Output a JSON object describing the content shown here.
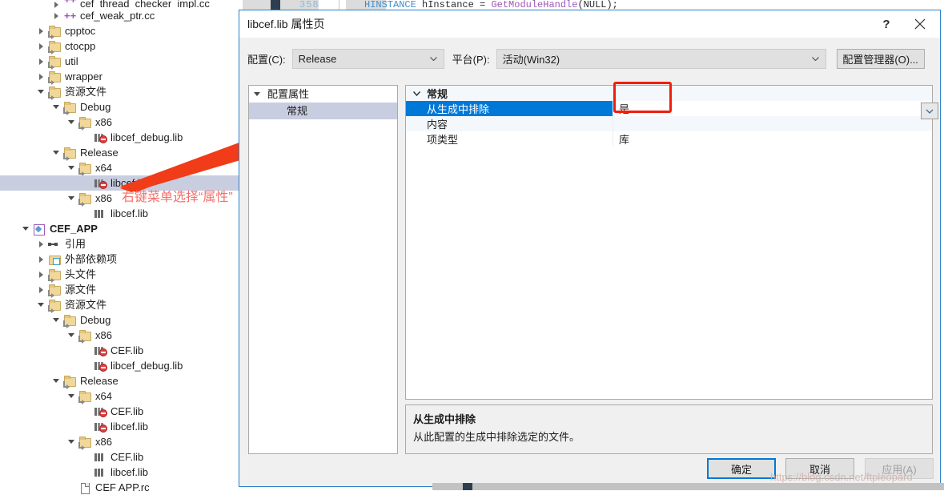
{
  "background": {
    "line_number": "358",
    "code_tokens": [
      {
        "t": "HINSTANCE",
        "c": "kw"
      },
      {
        "t": " hInstance ",
        "c": "id"
      },
      {
        "t": "= ",
        "c": "pn"
      },
      {
        "t": "GetModuleHandle",
        "c": "fn"
      },
      {
        "t": "(NULL);",
        "c": "pn"
      }
    ],
    "code_plain": "HINSTANCE hInstance = GetModuleHandle(NULL);"
  },
  "solution_tree": {
    "items": [
      {
        "label": "cef_thread_checker_impl.cc",
        "indent": 3,
        "twist": "collapsed",
        "icon": "cc-file-icon",
        "selected": false,
        "bold": false,
        "clipped": true
      },
      {
        "label": "cef_weak_ptr.cc",
        "indent": 3,
        "twist": "collapsed",
        "icon": "cc-file-icon",
        "selected": false,
        "bold": false
      },
      {
        "label": "cpptoc",
        "indent": 2,
        "twist": "collapsed",
        "icon": "folder-icon",
        "selected": false,
        "bold": false
      },
      {
        "label": "ctocpp",
        "indent": 2,
        "twist": "collapsed",
        "icon": "folder-icon",
        "selected": false,
        "bold": false
      },
      {
        "label": "util",
        "indent": 2,
        "twist": "collapsed",
        "icon": "folder-icon",
        "selected": false,
        "bold": false
      },
      {
        "label": "wrapper",
        "indent": 2,
        "twist": "collapsed",
        "icon": "folder-icon",
        "selected": false,
        "bold": false
      },
      {
        "label": "资源文件",
        "indent": 2,
        "twist": "expanded",
        "icon": "folder-icon",
        "selected": false,
        "bold": false
      },
      {
        "label": "Debug",
        "indent": 3,
        "twist": "expanded",
        "icon": "folder-icon",
        "selected": false,
        "bold": false
      },
      {
        "label": "x86",
        "indent": 4,
        "twist": "expanded",
        "icon": "folder-icon",
        "selected": false,
        "bold": false
      },
      {
        "label": "libcef_debug.lib",
        "indent": 5,
        "twist": "none",
        "icon": "lib-excluded-icon",
        "selected": false,
        "bold": false
      },
      {
        "label": "Release",
        "indent": 3,
        "twist": "expanded",
        "icon": "folder-icon",
        "selected": false,
        "bold": false
      },
      {
        "label": "x64",
        "indent": 4,
        "twist": "expanded",
        "icon": "folder-icon",
        "selected": false,
        "bold": false
      },
      {
        "label": "libcef.lib",
        "indent": 5,
        "twist": "none",
        "icon": "lib-excluded-icon",
        "selected": true,
        "bold": false
      },
      {
        "label": "x86",
        "indent": 4,
        "twist": "expanded",
        "icon": "folder-icon",
        "selected": false,
        "bold": false
      },
      {
        "label": "libcef.lib",
        "indent": 5,
        "twist": "none",
        "icon": "lib-icon",
        "selected": false,
        "bold": false
      },
      {
        "label": "CEF_APP",
        "indent": 1,
        "twist": "expanded",
        "icon": "project-icon",
        "selected": false,
        "bold": true
      },
      {
        "label": "引用",
        "indent": 2,
        "twist": "collapsed",
        "icon": "references-icon",
        "selected": false,
        "bold": false
      },
      {
        "label": "外部依赖项",
        "indent": 2,
        "twist": "collapsed",
        "icon": "external-deps-icon",
        "selected": false,
        "bold": false
      },
      {
        "label": "头文件",
        "indent": 2,
        "twist": "collapsed",
        "icon": "folder-icon",
        "selected": false,
        "bold": false
      },
      {
        "label": "源文件",
        "indent": 2,
        "twist": "collapsed",
        "icon": "folder-icon",
        "selected": false,
        "bold": false
      },
      {
        "label": "资源文件",
        "indent": 2,
        "twist": "expanded",
        "icon": "folder-icon",
        "selected": false,
        "bold": false
      },
      {
        "label": "Debug",
        "indent": 3,
        "twist": "expanded",
        "icon": "folder-icon",
        "selected": false,
        "bold": false
      },
      {
        "label": "x86",
        "indent": 4,
        "twist": "expanded",
        "icon": "folder-icon",
        "selected": false,
        "bold": false
      },
      {
        "label": "CEF.lib",
        "indent": 5,
        "twist": "none",
        "icon": "lib-excluded-icon",
        "selected": false,
        "bold": false
      },
      {
        "label": "libcef_debug.lib",
        "indent": 5,
        "twist": "none",
        "icon": "lib-excluded-icon",
        "selected": false,
        "bold": false
      },
      {
        "label": "Release",
        "indent": 3,
        "twist": "expanded",
        "icon": "folder-icon",
        "selected": false,
        "bold": false
      },
      {
        "label": "x64",
        "indent": 4,
        "twist": "expanded",
        "icon": "folder-icon",
        "selected": false,
        "bold": false
      },
      {
        "label": "CEF.lib",
        "indent": 5,
        "twist": "none",
        "icon": "lib-excluded-icon",
        "selected": false,
        "bold": false
      },
      {
        "label": "libcef.lib",
        "indent": 5,
        "twist": "none",
        "icon": "lib-excluded-icon",
        "selected": false,
        "bold": false
      },
      {
        "label": "x86",
        "indent": 4,
        "twist": "expanded",
        "icon": "folder-icon",
        "selected": false,
        "bold": false
      },
      {
        "label": "CEF.lib",
        "indent": 5,
        "twist": "none",
        "icon": "lib-icon",
        "selected": false,
        "bold": false
      },
      {
        "label": "libcef.lib",
        "indent": 5,
        "twist": "none",
        "icon": "lib-icon",
        "selected": false,
        "bold": false
      },
      {
        "label": "CEF APP.rc",
        "indent": 4,
        "twist": "none",
        "icon": "rc-file-icon",
        "selected": false,
        "bold": false
      }
    ]
  },
  "annotation": {
    "text": "右键菜单选择“属性”",
    "color": "#f4706a",
    "arrow_color": "#f03c18",
    "box_color": "#f01e0e"
  },
  "dialog": {
    "title": "libcef.lib 属性页",
    "help_glyph": "?",
    "close_glyph": "✕",
    "config_label": "配置(C):",
    "config_value": "Release",
    "platform_label": "平台(P):",
    "platform_value": "活动(Win32)",
    "config_manager_button": "配置管理器(O)...",
    "left_tree": [
      {
        "label": "配置属性",
        "indent": 0,
        "twist": "expanded",
        "selected": false
      },
      {
        "label": "常规",
        "indent": 1,
        "twist": "none",
        "selected": true
      }
    ],
    "grid": {
      "group_label": "常规",
      "rows": [
        {
          "name": "从生成中排除",
          "value": "是",
          "selected": true,
          "has_dropdown": true
        },
        {
          "name": "内容",
          "value": "",
          "selected": false,
          "has_dropdown": false
        },
        {
          "name": "项类型",
          "value": "库",
          "selected": false,
          "has_dropdown": false
        }
      ]
    },
    "description": {
      "title": "从生成中排除",
      "body": "从此配置的生成中排除选定的文件。"
    },
    "buttons": {
      "ok": "确定",
      "cancel": "取消",
      "apply": "应用(A)"
    },
    "accent_color": "#0078d7"
  },
  "watermark": {
    "text": "https://blog.csdn.net/ftpleopard"
  }
}
